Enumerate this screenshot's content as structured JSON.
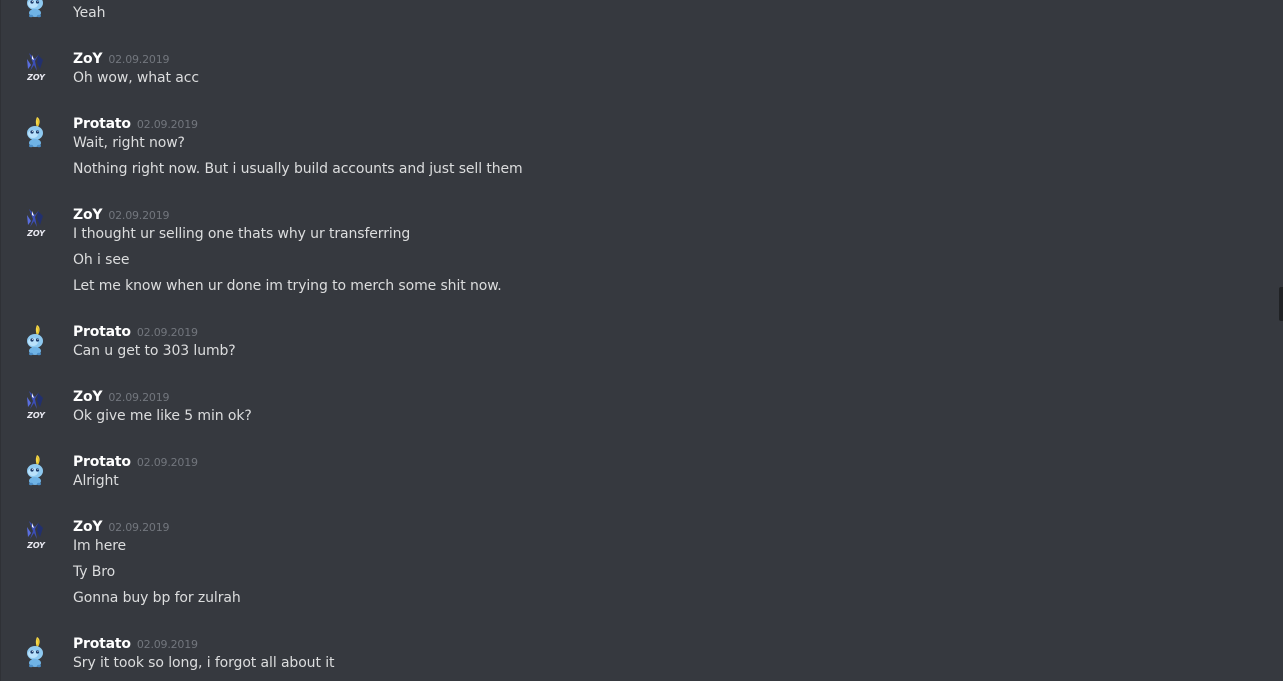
{
  "users": {
    "zoy": {
      "name": "ZoY",
      "avatar_icon": "zoy-logo-icon"
    },
    "protato": {
      "name": "Protato",
      "avatar_icon": "sobble-pokemon-icon"
    }
  },
  "colors": {
    "background": "#36393f",
    "username": "#ffffff",
    "timestamp": "#72767d",
    "message_text": "#dcddde"
  },
  "groups": [
    {
      "user": "",
      "date": "",
      "messages": [
        "Yeah"
      ]
    },
    {
      "user": "ZoY",
      "date": "02.09.2019",
      "messages": [
        "Oh wow, what acc"
      ]
    },
    {
      "user": "Protato",
      "date": "02.09.2019",
      "messages": [
        "Wait, right now?",
        "Nothing right now. But i usually build accounts and just sell them"
      ]
    },
    {
      "user": "ZoY",
      "date": "02.09.2019",
      "messages": [
        "I thought ur selling one thats why ur transferring",
        "Oh i see",
        "Let me know when ur done im trying to merch some shit now."
      ]
    },
    {
      "user": "Protato",
      "date": "02.09.2019",
      "messages": [
        "Can u get to 303 lumb?"
      ]
    },
    {
      "user": "ZoY",
      "date": "02.09.2019",
      "messages": [
        "Ok give me like 5 min ok?"
      ]
    },
    {
      "user": "Protato",
      "date": "02.09.2019",
      "messages": [
        "Alright"
      ]
    },
    {
      "user": "ZoY",
      "date": "02.09.2019",
      "messages": [
        "Im here",
        "Ty Bro",
        "Gonna buy bp for zulrah"
      ]
    },
    {
      "user": "Protato",
      "date": "02.09.2019",
      "messages": [
        "Sry it took so long, i forgot all about it"
      ]
    }
  ]
}
